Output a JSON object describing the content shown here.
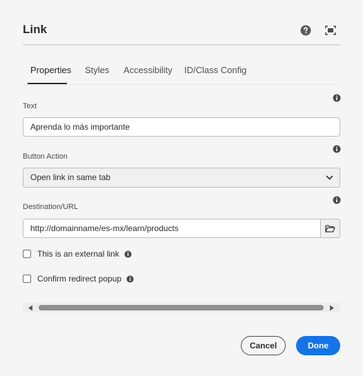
{
  "dialog": {
    "title": "Link",
    "help_icon": "help-circle-icon",
    "fullscreen_icon": "fullscreen-icon"
  },
  "tabs": [
    {
      "label": "Properties",
      "active": true
    },
    {
      "label": "Styles"
    },
    {
      "label": "Accessibility"
    },
    {
      "label": "ID/Class Config"
    }
  ],
  "fields": {
    "text": {
      "label": "Text",
      "value": "Aprenda lo más importante"
    },
    "button_action": {
      "label": "Button Action",
      "value": "Open link in same tab"
    },
    "destination": {
      "label": "Destination/URL",
      "value": "http://domainname/es-mx/learn/products"
    }
  },
  "checkboxes": {
    "external_link": {
      "label": "This is an external link",
      "checked": false
    },
    "confirm_redirect": {
      "label": "Confirm redirect popup",
      "checked": false
    }
  },
  "footer": {
    "cancel_label": "Cancel",
    "done_label": "Done"
  },
  "colors": {
    "accent": "#1473e6",
    "background": "#f5f5f5"
  }
}
